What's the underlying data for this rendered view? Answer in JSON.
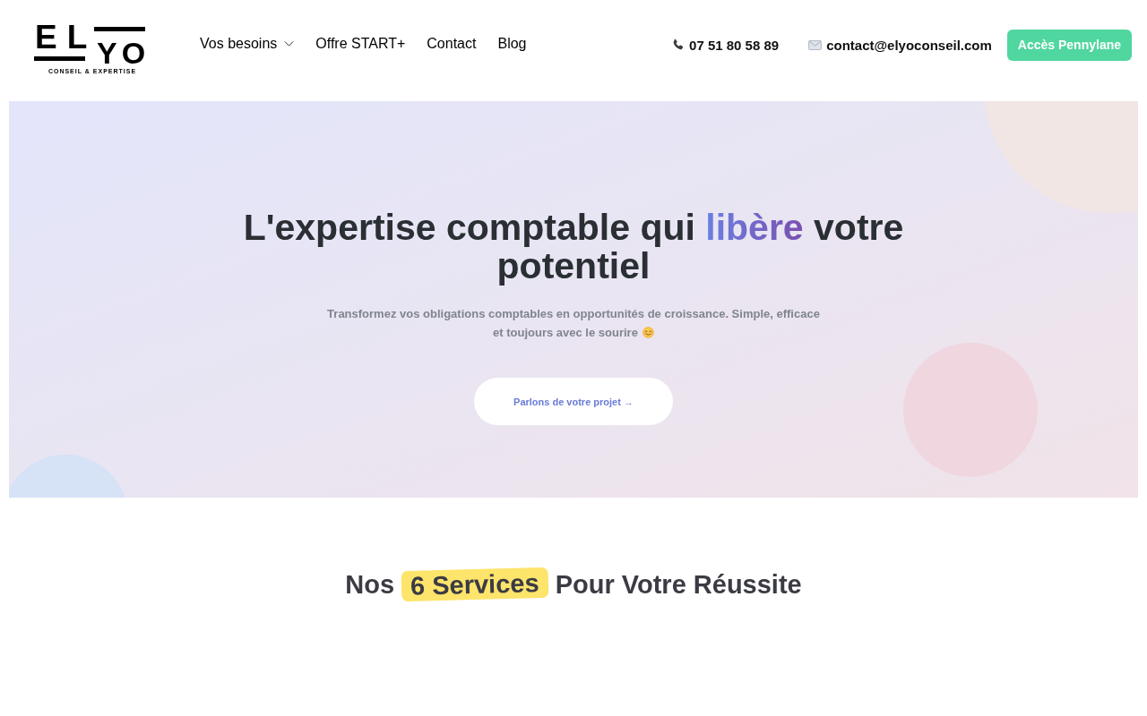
{
  "header": {
    "logo": {
      "top": "EL",
      "bottom": "YO",
      "tagline": "CONSEIL & EXPERTISE"
    },
    "nav": [
      {
        "label": "Vos besoins",
        "has_menu": true
      },
      {
        "label": "Offre START+",
        "has_menu": false
      },
      {
        "label": "Contact",
        "has_menu": false
      },
      {
        "label": "Blog",
        "has_menu": false
      }
    ],
    "contacts": [
      {
        "kind": "phone",
        "text": "07 51 80 58 89"
      },
      {
        "kind": "email",
        "text": "contact@elyoconseil.com"
      }
    ],
    "cta": "Accès Pennylane"
  },
  "hero": {
    "title": {
      "before": "L'expertise comptable qui ",
      "highlight": "libère",
      "after": " votre potentiel"
    },
    "subtitle_lines": [
      "Transformez vos obligations comptables en opportunités de croissance. Simple, efficace",
      "et toujours avec le sourire"
    ],
    "button": "Parlons de votre projet →"
  },
  "services": {
    "heading": {
      "before": "Nos ",
      "highlight": "6 Services",
      "after": " Pour Votre Réussite"
    }
  }
}
